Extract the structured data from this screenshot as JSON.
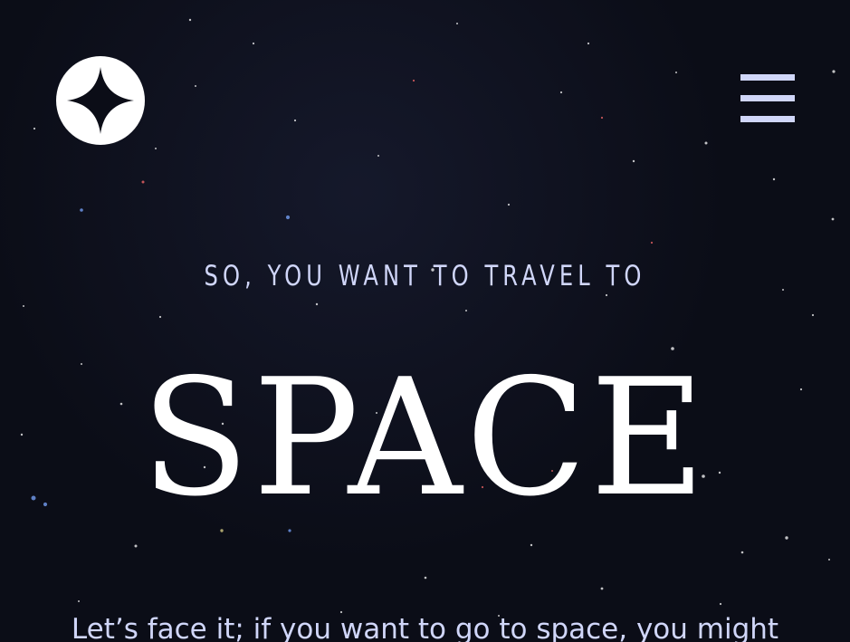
{
  "nav": {
    "logo": "star-logo-icon",
    "menu": "hamburger-menu-icon"
  },
  "hero": {
    "eyebrow": "SO, YOU WANT TO TRAVEL TO",
    "title": "SPACE",
    "body": "Let’s face it; if you want to go to space, you might"
  },
  "colors": {
    "background": "#0b0d17",
    "accent": "#d0d6f9",
    "white": "#ffffff"
  }
}
